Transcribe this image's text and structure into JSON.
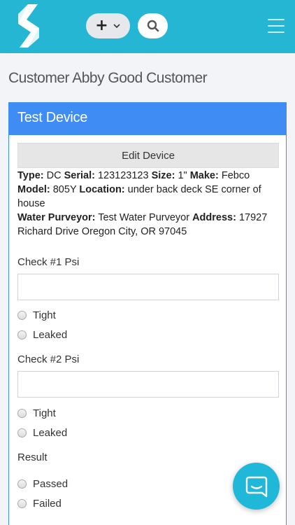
{
  "header": {
    "logo_icon": "app-logo-icon",
    "add_icon": "plus-icon",
    "add_label": "+",
    "search_icon": "search-icon",
    "menu_icon": "hamburger-menu-icon",
    "bar_color": "#24b6d3"
  },
  "page": {
    "title": "Customer Abby Good Customer"
  },
  "device_card": {
    "title": "Test Device",
    "header_color": "#3f8cf5",
    "edit_label": "Edit Device",
    "info": {
      "type_label": "Type:",
      "type_value": " DC ",
      "serial_label": "Serial:",
      "serial_value": " 123123123 ",
      "size_label": "Size:",
      "size_value": " 1\" ",
      "make_label": "Make:",
      "make_value": " Febco",
      "model_label": "Model:",
      "model_value": " 805Y ",
      "location_label": "Location:",
      "location_value": " under back deck SE corner of house",
      "purveyor_label": "Water Purveyor:",
      "purveyor_value": " Test Water Purveyor ",
      "address_label": "Address:",
      "address_value": " 17927 Richard Drive Oregon City, OR 97045"
    },
    "check1": {
      "label": "Check #1 Psi",
      "value": "",
      "options": [
        "Tight",
        "Leaked"
      ]
    },
    "check2": {
      "label": "Check #2 Psi",
      "value": "",
      "options": [
        "Tight",
        "Leaked"
      ]
    },
    "result": {
      "label": "Result",
      "options": [
        "Passed",
        "Failed"
      ]
    }
  },
  "chat": {
    "icon": "chat-bubble-icon",
    "color": "#1fb8d8"
  }
}
